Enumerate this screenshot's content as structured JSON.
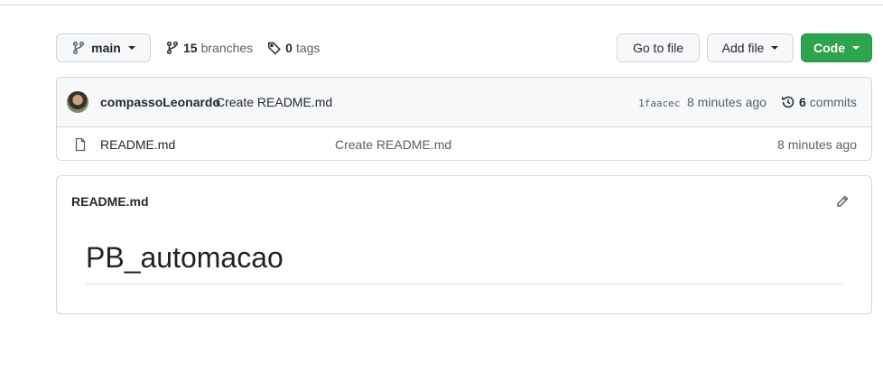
{
  "toolbar": {
    "branch": "main",
    "branches_count": "15",
    "branches_label": "branches",
    "tags_count": "0",
    "tags_label": "tags",
    "goto_file": "Go to file",
    "add_file": "Add file",
    "code": "Code"
  },
  "latest_commit": {
    "author": "compassoLeonardo",
    "message": "Create README.md",
    "sha": "1faacec",
    "time": "8 minutes ago",
    "commits_count": "6",
    "commits_label": "commits"
  },
  "files": [
    {
      "name": "README.md",
      "message": "Create README.md",
      "time": "8 minutes ago",
      "icon": "file-icon"
    }
  ],
  "readme": {
    "filename": "README.md",
    "heading": "PB_automacao"
  },
  "colors": {
    "code_button": "#2da44e",
    "border": "#d0d7de",
    "muted_text": "#57606a"
  }
}
